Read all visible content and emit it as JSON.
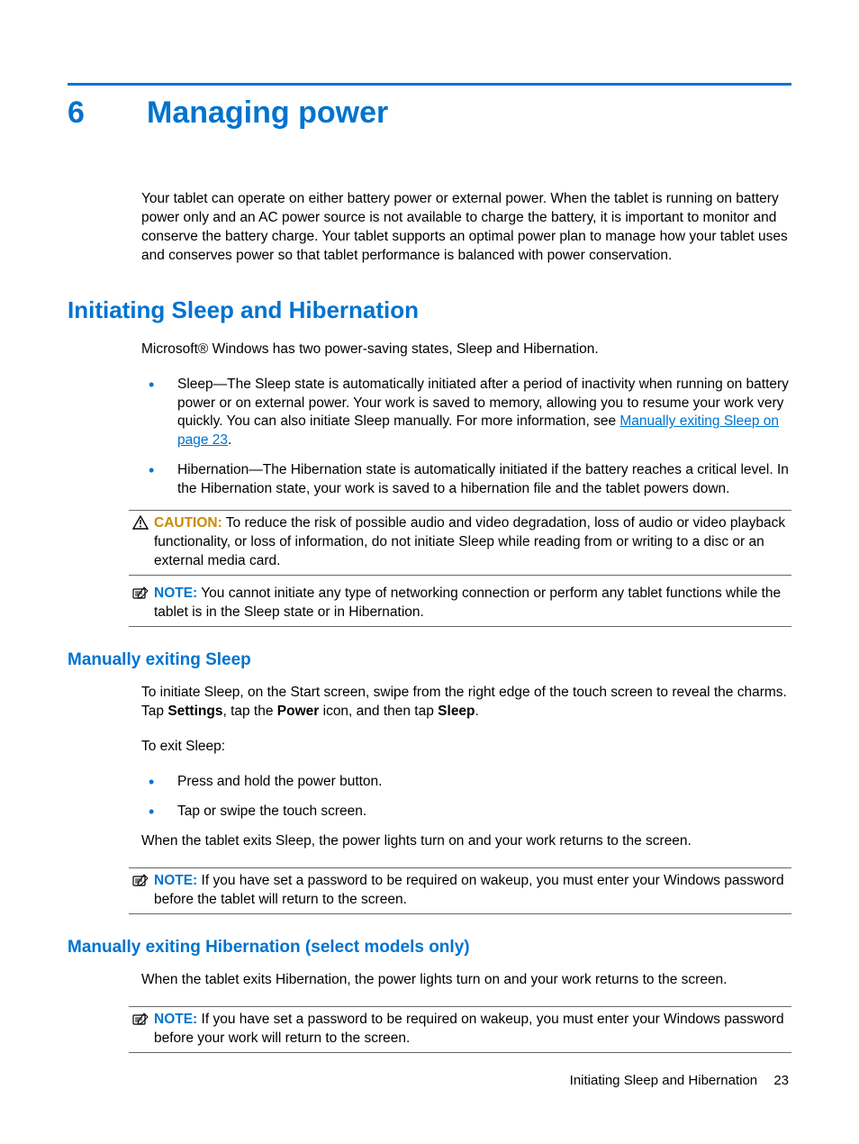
{
  "chapter": {
    "number": "6",
    "title": "Managing power"
  },
  "intro": "Your tablet can operate on either battery power or external power. When the tablet is running on battery power only and an AC power source is not available to charge the battery, it is important to monitor and conserve the battery charge. Your tablet supports an optimal power plan to manage how your tablet uses and conserves power so that tablet performance is balanced with power conservation.",
  "section1": {
    "title": "Initiating Sleep and Hibernation",
    "p1": "Microsoft® Windows has two power-saving states, Sleep and Hibernation.",
    "li1a": "Sleep—The Sleep state is automatically initiated after a period of inactivity when running on battery power or on external power. Your work is saved to memory, allowing you to resume your work very quickly. You can also initiate Sleep manually. For more information, see ",
    "li1_link": "Manually exiting Sleep on page 23",
    "li1b": ".",
    "li2": "Hibernation—The Hibernation state is automatically initiated if the battery reaches a critical level. In the Hibernation state, your work is saved to a hibernation file and the tablet powers down.",
    "caution_label": "CAUTION:",
    "caution_text": "   To reduce the risk of possible audio and video degradation, loss of audio or video playback functionality, or loss of information, do not initiate Sleep while reading from or writing to a disc or an external media card.",
    "note1_label": "NOTE:",
    "note1_text": "   You cannot initiate any type of networking connection or perform any tablet functions while the tablet is in the Sleep state or in Hibernation."
  },
  "sub1": {
    "title": "Manually exiting Sleep",
    "p1a": "To initiate Sleep, on the Start screen, swipe from the right edge of the touch screen to reveal the charms. Tap ",
    "b1": "Settings",
    "p1b": ", tap the ",
    "b2": "Power",
    "p1c": " icon, and then tap ",
    "b3": "Sleep",
    "p1d": ".",
    "p2": "To exit Sleep:",
    "li1": "Press and hold the power button.",
    "li2": "Tap or swipe the touch screen.",
    "p3": "When the tablet exits Sleep, the power lights turn on and your work returns to the screen.",
    "note_label": "NOTE:",
    "note_text": "   If you have set a password to be required on wakeup, you must enter your Windows password before the tablet will return to the screen."
  },
  "sub2": {
    "title": "Manually exiting Hibernation (select models only)",
    "p1": "When the tablet exits Hibernation, the power lights turn on and your work returns to the screen.",
    "note_label": "NOTE:",
    "note_text": "   If you have set a password to be required on wakeup, you must enter your Windows password before your work will return to the screen."
  },
  "footer": {
    "text": "Initiating Sleep and Hibernation",
    "page": "23"
  }
}
